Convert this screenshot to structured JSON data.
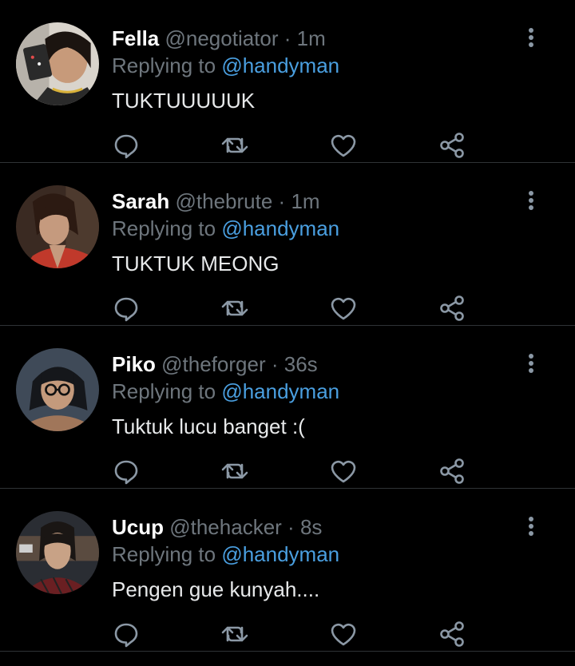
{
  "tweets": [
    {
      "name": "Fella",
      "handle": "@negotiator",
      "separator": "·",
      "time": "1m",
      "replying_prefix": "Replying to",
      "replying_to": "@handyman",
      "text": "TUKTUUUUUK"
    },
    {
      "name": "Sarah",
      "handle": "@thebrute",
      "separator": "·",
      "time": "1m",
      "replying_prefix": "Replying to",
      "replying_to": "@handyman",
      "text": "TUKTUK MEONG"
    },
    {
      "name": "Piko",
      "handle": "@theforger",
      "separator": "·",
      "time": "36s",
      "replying_prefix": "Replying to",
      "replying_to": "@handyman",
      "text": "Tuktuk lucu banget :("
    },
    {
      "name": "Ucup",
      "handle": "@thehacker",
      "separator": "·",
      "time": "8s",
      "replying_prefix": "Replying to",
      "replying_to": "@handyman",
      "text": "Pengen gue kunyah...."
    }
  ],
  "icons": {
    "reply": "reply-icon",
    "retweet": "retweet-icon",
    "like": "heart-icon",
    "share": "share-icon",
    "more": "more-vertical-icon"
  },
  "colors": {
    "background": "#000000",
    "divider": "#2f3336",
    "muted": "#6e767d",
    "mention": "#4a9fe0",
    "text": "#e7e9ea"
  }
}
